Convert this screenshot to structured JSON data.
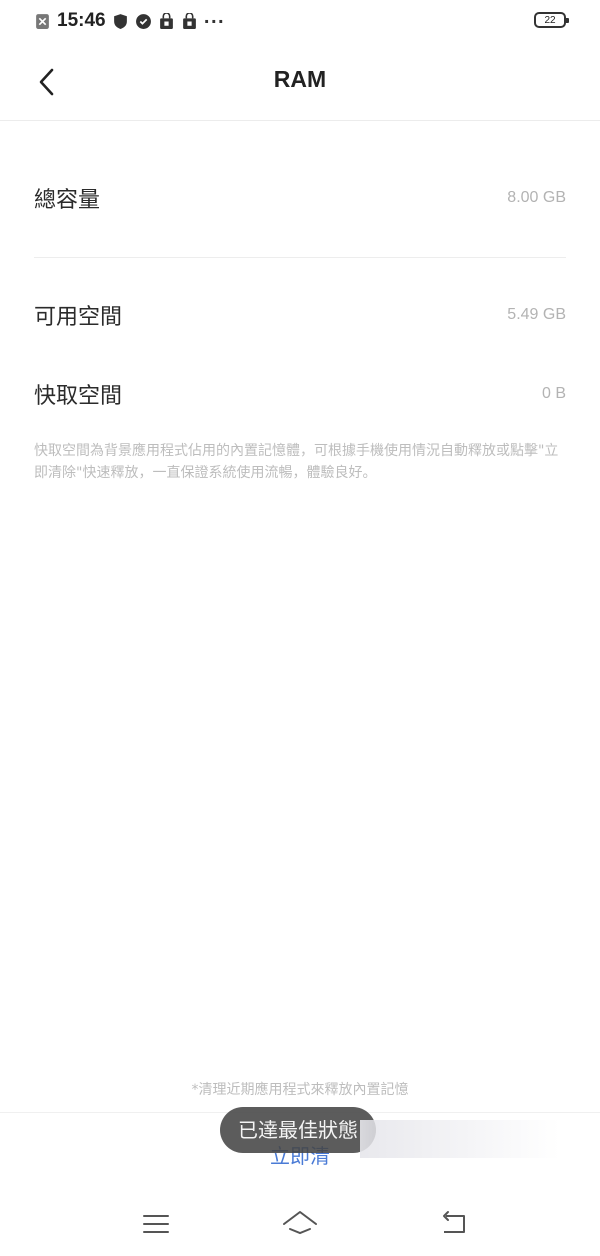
{
  "status_bar": {
    "time": "15:46",
    "more": "···",
    "battery": "22",
    "icons": [
      "sim-icon",
      "shield-icon",
      "vpn-icon",
      "bag-icon",
      "bag-icon"
    ]
  },
  "header": {
    "title": "RAM",
    "back_icon": "chevron-left-icon"
  },
  "memory": {
    "total_label": "總容量",
    "total_value": "8.00 GB",
    "available_label": "可用空間",
    "available_value": "5.49 GB",
    "cache_label": "快取空間",
    "cache_value": "0 B"
  },
  "description": "快取空間為背景應用程式佔用的內置記憶體，可根據手機使用情況自動釋放或點擊\"立即清除\"快速釋放，一直保證系統使用流暢，體驗良好。",
  "footer": {
    "note": "*清理近期應用程式來釋放內置記憶",
    "clean_button": "立即清"
  },
  "toast": "已達最佳狀態",
  "nav": {
    "menu_icon": "menu-icon",
    "home_icon": "home-icon",
    "back_icon": "back-arrow-icon"
  },
  "colors": {
    "accent": "#4a7bd6",
    "value_text": "#b3b3b3",
    "toast_bg": "#464646"
  }
}
